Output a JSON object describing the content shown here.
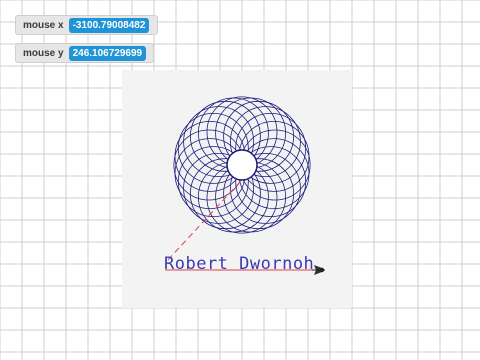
{
  "monitors": {
    "x": {
      "label": "mouse x",
      "value": "-3100.79008482"
    },
    "y": {
      "label": "mouse y",
      "value": "246.106729699"
    }
  },
  "canvas": {
    "signature": "Robert Dwornoh",
    "icons": {
      "pen": "pen-sprite-icon"
    }
  },
  "colors": {
    "grid": "#cfcfcf",
    "panel": "#f3f3f3",
    "spiral": "#1c1c7a",
    "dashed_line": "#e0404a",
    "signature": "#3b3bb0",
    "monitor_value_bg": "#1f94d6"
  }
}
